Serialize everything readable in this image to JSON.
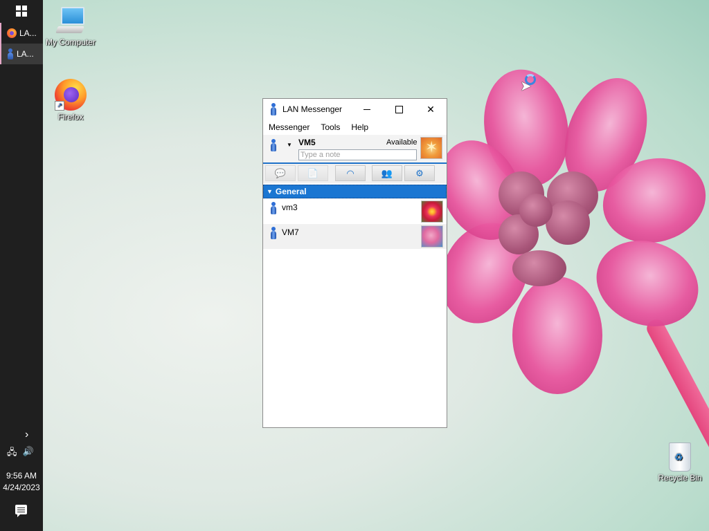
{
  "taskbar": {
    "apps": [
      {
        "label": "LA...",
        "icon": "firefox-icon"
      },
      {
        "label": "LA...",
        "icon": "lan-messenger-icon"
      }
    ],
    "time": "9:56 AM",
    "date": "4/24/2023"
  },
  "desktop": {
    "icons": [
      {
        "label": "My Computer",
        "icon": "computer-icon"
      },
      {
        "label": "Firefox",
        "icon": "firefox-icon"
      },
      {
        "label": "Recycle Bin",
        "icon": "recycle-bin-icon"
      }
    ]
  },
  "window": {
    "title": "LAN Messenger",
    "menu": [
      "Messenger",
      "Tools",
      "Help"
    ],
    "user": {
      "name": "VM5",
      "status": "Available",
      "note_placeholder": "Type a note",
      "note_value": ""
    },
    "toolbar": [
      {
        "name": "chat-icon",
        "enabled": false
      },
      {
        "name": "file-transfer-icon",
        "enabled": false
      },
      {
        "name": "broadcast-icon",
        "enabled": true
      },
      {
        "name": "add-contact-icon",
        "enabled": true
      },
      {
        "name": "network-icon",
        "enabled": true
      }
    ],
    "group": {
      "name": "General",
      "expanded": true
    },
    "contacts": [
      {
        "name": "vm3",
        "avatar": "flower"
      },
      {
        "name": "VM7",
        "avatar": "pink"
      }
    ]
  },
  "colors": {
    "taskbar_bg": "#1f1f1f",
    "group_header_bg": "#1a76d2",
    "accent_line": "#1e72c9"
  }
}
